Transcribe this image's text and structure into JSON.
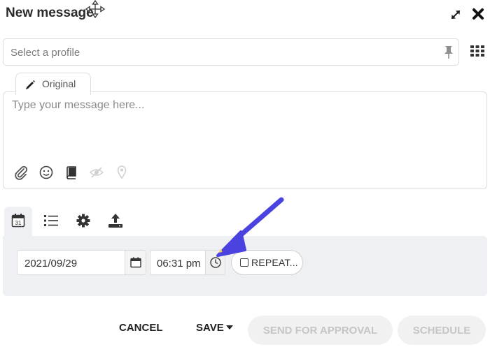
{
  "header": {
    "title": "New message",
    "icons": [
      "move-icon",
      "expand-icon",
      "close-icon"
    ]
  },
  "profile": {
    "placeholder": "Select a profile",
    "value": "",
    "icons": [
      "pin-icon",
      "grid-icon"
    ]
  },
  "editor": {
    "tab_label": "Original",
    "placeholder": "Type your message here...",
    "value": "",
    "toolbar_icons": [
      "paperclip-icon",
      "emoji-icon",
      "book-icon",
      "eye-slash-icon",
      "location-pin-icon"
    ]
  },
  "schedule_tabs": [
    {
      "name": "calendar-icon",
      "day": "31",
      "active": true
    },
    {
      "name": "list-icon",
      "active": false
    },
    {
      "name": "gear-icon",
      "active": false
    },
    {
      "name": "upload-icon",
      "active": false
    }
  ],
  "schedule": {
    "date": "2021/09/29",
    "time": "06:31 pm",
    "repeat_label": "REPEAT..."
  },
  "footer": {
    "cancel": "CANCEL",
    "save": "SAVE",
    "send_for_approval": "SEND FOR APPROVAL",
    "schedule": "SCHEDULE"
  },
  "colors": {
    "panel_bg": "#eef0f3",
    "annotation_arrow": "#4a43e0",
    "disabled_text": "#c5c5c5"
  }
}
